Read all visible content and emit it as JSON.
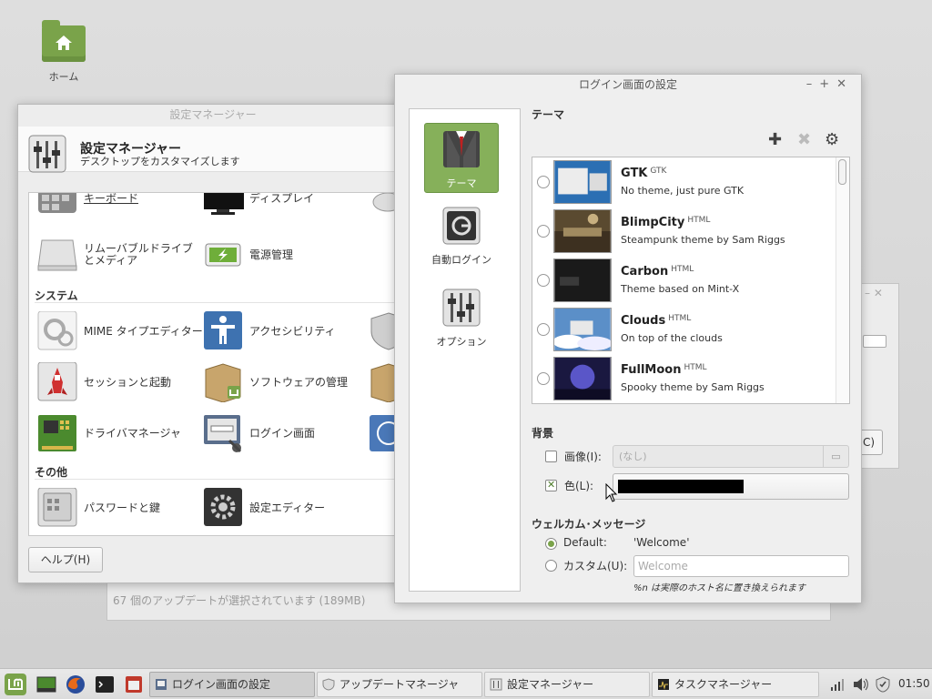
{
  "desktop": {
    "home_label": "ホーム"
  },
  "update_window": {
    "status": "67 個のアップデートが選択されています (189MB)"
  },
  "small_dialog": {
    "button_fragment": "C)"
  },
  "settings_window": {
    "title": "設定マネージャー",
    "header_title": "設定マネージャー",
    "header_subtitle": "デスクトップをカスタマイズします",
    "items_top": [
      "キーボード",
      "ディスプレイ"
    ],
    "item_removable": "リムーバブルドライブとメディア",
    "item_power": "電源管理",
    "section_system": "システム",
    "system_items": [
      "MIME タイプエディター",
      "アクセシビリティ",
      "セッションと起動",
      "ソフトウェアの管理",
      "ドライバマネージャ",
      "ログイン画面"
    ],
    "section_other": "その他",
    "other_items": [
      "パスワードと鍵",
      "設定エディター"
    ],
    "help_button": "ヘルプ(H)"
  },
  "login_window": {
    "title": "ログイン画面の設定",
    "tabs": [
      "テーマ",
      "自動ログイン",
      "オプション"
    ],
    "theme_label": "テーマ",
    "themes": [
      {
        "name": "GTK",
        "type": "GTK",
        "desc": "No theme, just pure GTK"
      },
      {
        "name": "BlimpCity",
        "type": "HTML",
        "desc": "Steampunk theme by Sam Riggs"
      },
      {
        "name": "Carbon",
        "type": "HTML",
        "desc": "Theme based on Mint-X"
      },
      {
        "name": "Clouds",
        "type": "HTML",
        "desc": "On top of the clouds"
      },
      {
        "name": "FullMoon",
        "type": "HTML",
        "desc": "Spooky theme by Sam Riggs"
      }
    ],
    "background_label": "背景",
    "image_label": "画像(I):",
    "image_value": "(なし)",
    "color_label": "色(L):",
    "color_value": "#000000",
    "welcome_label": "ウェルカム･メッセージ",
    "default_label": "Default:",
    "default_value": "'Welcome'",
    "custom_label": "カスタム(U):",
    "custom_placeholder": "Welcome",
    "hint": "%n は実際のホスト名に置き換えられます"
  },
  "taskbar": {
    "tasks": [
      "ログイン画面の設定",
      "アップデートマネージャ",
      "設定マネージャー",
      "タスクマネージャー"
    ],
    "clock": "01:50"
  }
}
